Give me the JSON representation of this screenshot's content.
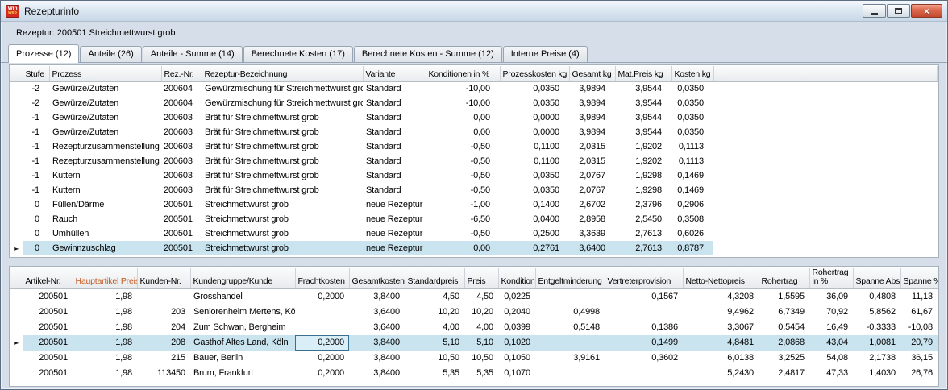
{
  "window": {
    "title": "Rezepturinfo",
    "logo_top": "Win",
    "logo_bottom": "web"
  },
  "icons": {
    "close_glyph": "×",
    "row_marker": "►"
  },
  "header": {
    "recipe_label": "Rezeptur: 200501 Streichmettwurst grob"
  },
  "tabs": [
    {
      "label": "Prozesse (12)",
      "active": true
    },
    {
      "label": "Anteile (26)",
      "active": false
    },
    {
      "label": "Anteile - Summe (14)",
      "active": false
    },
    {
      "label": "Berechnete Kosten (17)",
      "active": false
    },
    {
      "label": "Berechnete Kosten - Summe (12)",
      "active": false
    },
    {
      "label": "Interne Preise (4)",
      "active": false
    }
  ],
  "process_table": {
    "columns": [
      "Stufe",
      "Prozess",
      "Rez.-Nr.",
      "Rezeptur-Bezeichnung",
      "Variante",
      "Konditionen in %",
      "Prozesskosten kg",
      "Gesamt kg",
      "Mat.Preis kg",
      "Kosten kg"
    ],
    "selected_row": 11,
    "rows": [
      [
        "-2",
        "Gewürze/Zutaten",
        "200604",
        "Gewürzmischung für Streichmettwurst grob",
        "Standard",
        "-10,00",
        "0,0350",
        "3,9894",
        "3,9544",
        "0,0350"
      ],
      [
        "-2",
        "Gewürze/Zutaten",
        "200604",
        "Gewürzmischung für Streichmettwurst grob",
        "Standard",
        "-10,00",
        "0,0350",
        "3,9894",
        "3,9544",
        "0,0350"
      ],
      [
        "-1",
        "Gewürze/Zutaten",
        "200603",
        "Brät für Streichmettwurst grob",
        "Standard",
        "0,00",
        "0,0000",
        "3,9894",
        "3,9544",
        "0,0350"
      ],
      [
        "-1",
        "Gewürze/Zutaten",
        "200603",
        "Brät für Streichmettwurst grob",
        "Standard",
        "0,00",
        "0,0000",
        "3,9894",
        "3,9544",
        "0,0350"
      ],
      [
        "-1",
        "Rezepturzusammenstellung",
        "200603",
        "Brät für Streichmettwurst grob",
        "Standard",
        "-0,50",
        "0,1100",
        "2,0315",
        "1,9202",
        "0,1113"
      ],
      [
        "-1",
        "Rezepturzusammenstellung",
        "200603",
        "Brät für Streichmettwurst grob",
        "Standard",
        "-0,50",
        "0,1100",
        "2,0315",
        "1,9202",
        "0,1113"
      ],
      [
        "-1",
        "Kuttern",
        "200603",
        "Brät für Streichmettwurst grob",
        "Standard",
        "-0,50",
        "0,0350",
        "2,0767",
        "1,9298",
        "0,1469"
      ],
      [
        "-1",
        "Kuttern",
        "200603",
        "Brät für Streichmettwurst grob",
        "Standard",
        "-0,50",
        "0,0350",
        "2,0767",
        "1,9298",
        "0,1469"
      ],
      [
        "0",
        "Füllen/Därme",
        "200501",
        "Streichmettwurst grob",
        "neue Rezeptur",
        "-1,00",
        "0,1400",
        "2,6702",
        "2,3796",
        "0,2906"
      ],
      [
        "0",
        "Rauch",
        "200501",
        "Streichmettwurst grob",
        "neue Rezeptur",
        "-6,50",
        "0,0400",
        "2,8958",
        "2,5450",
        "0,3508"
      ],
      [
        "0",
        "Umhüllen",
        "200501",
        "Streichmettwurst grob",
        "neue Rezeptur",
        "-0,50",
        "0,2500",
        "3,3639",
        "2,7613",
        "0,6026"
      ],
      [
        "0",
        "Gewinnzuschlag",
        "200501",
        "Streichmettwurst grob",
        "neue Rezeptur",
        "0,00",
        "0,2761",
        "3,6400",
        "2,7613",
        "0,8787"
      ]
    ]
  },
  "price_table": {
    "columns": [
      "Artikel-Nr.",
      "Hauptartikel Preis",
      "Kunden-Nr.",
      "Kundengruppe/Kunde",
      "Frachtkosten",
      "Gesamtkosten",
      "Standardpreis",
      "Preis",
      "Kondition",
      "Entgeltminderung",
      "Vertreterprovision",
      "Netto-Nettopreis",
      "Rohertrag",
      "Rohertrag in %",
      "Spanne Abs.",
      "Spanne %"
    ],
    "selected_row": 3,
    "focused_cell": {
      "row": 3,
      "col": 4
    },
    "rows": [
      [
        "200501",
        "1,98",
        "",
        "Grosshandel",
        "0,2000",
        "3,8400",
        "4,50",
        "4,50",
        "0,0225",
        "",
        "0,1567",
        "4,3208",
        "1,5595",
        "36,09",
        "0,4808",
        "11,13"
      ],
      [
        "200501",
        "1,98",
        "203",
        "Seniorenheim Mertens, Köln",
        "",
        "3,6400",
        "10,20",
        "10,20",
        "0,2040",
        "0,4998",
        "",
        "9,4962",
        "6,7349",
        "70,92",
        "5,8562",
        "61,67"
      ],
      [
        "200501",
        "1,98",
        "204",
        "Zum Schwan, Bergheim",
        "",
        "3,6400",
        "4,00",
        "4,00",
        "0,0399",
        "0,5148",
        "0,1386",
        "3,3067",
        "0,5454",
        "16,49",
        "-0,3333",
        "-10,08"
      ],
      [
        "200501",
        "1,98",
        "208",
        "Gasthof Altes Land, Köln",
        "0,2000",
        "3,8400",
        "5,10",
        "5,10",
        "0,1020",
        "",
        "0,1499",
        "4,8481",
        "2,0868",
        "43,04",
        "1,0081",
        "20,79"
      ],
      [
        "200501",
        "1,98",
        "215",
        "Bauer, Berlin",
        "0,2000",
        "3,8400",
        "10,50",
        "10,50",
        "0,1050",
        "3,9161",
        "0,3602",
        "6,0138",
        "3,2525",
        "54,08",
        "2,1738",
        "36,15"
      ],
      [
        "200501",
        "1,98",
        "113450",
        "Brum, Frankfurt",
        "0,2000",
        "3,8400",
        "5,35",
        "5,35",
        "0,1070",
        "",
        "",
        "5,2430",
        "2,4817",
        "47,33",
        "1,4030",
        "26,76"
      ]
    ]
  },
  "colors": {
    "selection": "#c9e3ef",
    "accent_header": "#c25a1e",
    "close_button": "#c3492e"
  }
}
